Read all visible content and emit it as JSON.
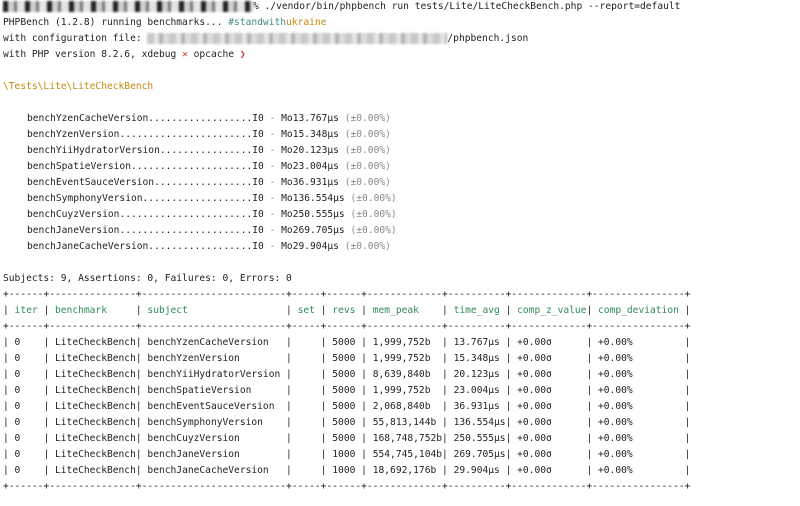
{
  "command": {
    "prompt": "%",
    "text": " ./vendor/bin/phpbench run tests/Lite/LiteCheckBench.php --report=default"
  },
  "intro": {
    "running": "PHPBench (1.2.8) running benchmarks... ",
    "tag_prefix": "#standwith",
    "tag_suffix": "ukraine",
    "config_prefix": "with configuration file: ",
    "config_suffix": "/phpbench.json",
    "php_prefix": "with PHP version 8.2.6, xdebug ",
    "xdebug_mark": "✕",
    "opcache": " opcache ",
    "opcache_mark": "❯"
  },
  "suite": "\\Tests\\Lite\\LiteCheckBench",
  "benchmarks": [
    {
      "label": "benchYzenCacheVersion..................",
      "io": "I0",
      "mo": "Mo13.767μs",
      "dev": "(±0.00%)"
    },
    {
      "label": "benchYzenVersion.......................",
      "io": "I0",
      "mo": "Mo15.348μs",
      "dev": "(±0.00%)"
    },
    {
      "label": "benchYiiHydratorVersion................",
      "io": "I0",
      "mo": "Mo20.123μs",
      "dev": "(±0.00%)"
    },
    {
      "label": "benchSpatieVersion.....................",
      "io": "I0",
      "mo": "Mo23.004μs",
      "dev": "(±0.00%)"
    },
    {
      "label": "benchEventSauceVersion.................",
      "io": "I0",
      "mo": "Mo36.931μs",
      "dev": "(±0.00%)"
    },
    {
      "label": "benchSymphonyVersion...................",
      "io": "I0",
      "mo": "Mo136.554μs",
      "dev": "(±0.00%)"
    },
    {
      "label": "benchCuyzVersion.......................",
      "io": "I0",
      "mo": "Mo250.555μs",
      "dev": "(±0.00%)"
    },
    {
      "label": "benchJaneVersion.......................",
      "io": "I0",
      "mo": "Mo269.705μs",
      "dev": "(±0.00%)"
    },
    {
      "label": "benchJaneCacheVersion..................",
      "io": "I0",
      "mo": "Mo29.904μs",
      "dev": "(±0.00%)"
    }
  ],
  "summary": "Subjects: 9, Assertions: 0, Failures: 0, Errors: 0",
  "table": {
    "border": "+------+---------------+-------------------------+-----+------+-------------+----------+-------------+----------------+",
    "headers": [
      "iter",
      "benchmark",
      "subject",
      "set",
      "revs",
      "mem_peak",
      "time_avg",
      "comp_z_value",
      "comp_deviation"
    ],
    "rows": [
      [
        "0",
        "LiteCheckBench",
        "benchYzenCacheVersion",
        "",
        "5000",
        "1,999,752b",
        "13.767μs",
        "+0.00σ",
        "+0.00%"
      ],
      [
        "0",
        "LiteCheckBench",
        "benchYzenVersion",
        "",
        "5000",
        "1,999,752b",
        "15.348μs",
        "+0.00σ",
        "+0.00%"
      ],
      [
        "0",
        "LiteCheckBench",
        "benchYiiHydratorVersion",
        "",
        "5000",
        "8,639,840b",
        "20.123μs",
        "+0.00σ",
        "+0.00%"
      ],
      [
        "0",
        "LiteCheckBench",
        "benchSpatieVersion",
        "",
        "5000",
        "1,999,752b",
        "23.004μs",
        "+0.00σ",
        "+0.00%"
      ],
      [
        "0",
        "LiteCheckBench",
        "benchEventSauceVersion",
        "",
        "5000",
        "2,068,840b",
        "36.931μs",
        "+0.00σ",
        "+0.00%"
      ],
      [
        "0",
        "LiteCheckBench",
        "benchSymphonyVersion",
        "",
        "5000",
        "55,813,144b",
        "136.554μs",
        "+0.00σ",
        "+0.00%"
      ],
      [
        "0",
        "LiteCheckBench",
        "benchCuyzVersion",
        "",
        "5000",
        "168,748,752b",
        "250.555μs",
        "+0.00σ",
        "+0.00%"
      ],
      [
        "0",
        "LiteCheckBench",
        "benchJaneVersion",
        "",
        "1000",
        "554,745,104b",
        "269.705μs",
        "+0.00σ",
        "+0.00%"
      ],
      [
        "0",
        "LiteCheckBench",
        "benchJaneCacheVersion",
        "",
        "1000",
        "18,692,176b",
        "29.904μs",
        "+0.00σ",
        "+0.00%"
      ]
    ]
  },
  "colors": {
    "suite": "#c8870f",
    "header": "#2e8b57",
    "mark": "#d32f2f",
    "dim": "#8a8a8a"
  }
}
